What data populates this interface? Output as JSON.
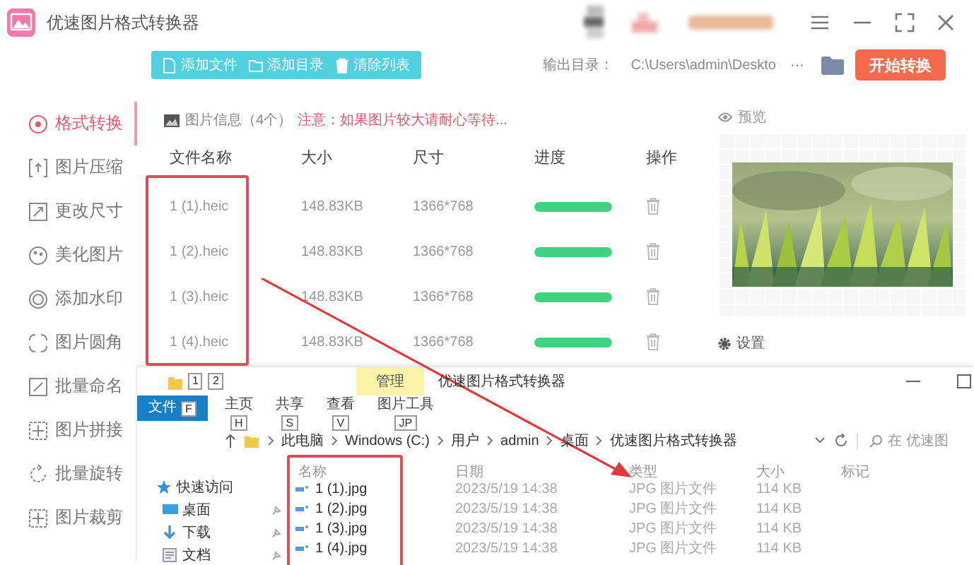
{
  "window": {
    "title": "优速图片格式转换器"
  },
  "toolbar": {
    "buttons": [
      "添加文件",
      "添加目录",
      "清除列表"
    ],
    "output_label": "输出目录：",
    "output_path": "C:\\Users\\admin\\Deskto",
    "more": "···",
    "start_button": "开始转换"
  },
  "sidebar": {
    "items": [
      {
        "label": "格式转换",
        "selected": true
      },
      {
        "label": "图片压缩",
        "selected": false
      },
      {
        "label": "更改尺寸",
        "selected": false
      },
      {
        "label": "美化图片",
        "selected": false
      },
      {
        "label": "添加水印",
        "selected": false
      },
      {
        "label": "图片圆角",
        "selected": false
      },
      {
        "label": "批量命名",
        "selected": false
      },
      {
        "label": "图片拼接",
        "selected": false
      },
      {
        "label": "批量旋转",
        "selected": false
      },
      {
        "label": "图片裁剪",
        "selected": false
      }
    ]
  },
  "file_panel": {
    "info_label": "图片信息（4个）",
    "notice": "注意：如果图片较大请耐心等待...",
    "columns": [
      "文件名称",
      "大小",
      "尺寸",
      "进度",
      "操作"
    ],
    "rows": [
      {
        "name": "1 (1).heic",
        "size": "148.83KB",
        "dimensions": "1366*768",
        "level": 1
      },
      {
        "name": "1 (2).heic",
        "size": "148.83KB",
        "dimensions": "1366*768",
        "level": 1
      },
      {
        "name": "1 (3).heic",
        "size": "148.83KB",
        "dimensions": "1366*768",
        "level": 1
      },
      {
        "name": "1 (4).heic",
        "size": "148.83KB",
        "dimensions": "1366*768",
        "level": 1
      }
    ]
  },
  "preview": {
    "title": "预览",
    "settings_label": "设置"
  },
  "explorer": {
    "quick_access_tips": [
      "1",
      "2"
    ],
    "context_tab": "管理",
    "title": "优速图片格式转换器",
    "ribbon": [
      {
        "label": "文件",
        "key_tip": "F",
        "selected": true
      },
      {
        "label": "主页",
        "key_tip": "H",
        "selected": false
      },
      {
        "label": "共享",
        "key_tip": "S",
        "selected": false
      },
      {
        "label": "查看",
        "key_tip": "V",
        "selected": false
      },
      {
        "label": "图片工具",
        "key_tip": "JP",
        "selected": false
      }
    ],
    "path": [
      "此电脑",
      "Windows (C:)",
      "用户",
      "admin",
      "桌面",
      "优速图片格式转换器"
    ],
    "search_placeholder": "在 优速图",
    "columns": [
      "名称",
      "日期",
      "类型",
      "大小",
      "标记"
    ],
    "nav": [
      {
        "label": "快速访问",
        "kind": "group"
      },
      {
        "label": "桌面",
        "kind": "item"
      },
      {
        "label": "下载",
        "kind": "item"
      },
      {
        "label": "文档",
        "kind": "item"
      }
    ],
    "files": [
      {
        "name": "1 (1).jpg",
        "date": "2023/5/19 14:38",
        "type": "JPG 图片文件",
        "size": "114 KB"
      },
      {
        "name": "1 (2).jpg",
        "date": "2023/5/19 14:38",
        "type": "JPG 图片文件",
        "size": "114 KB"
      },
      {
        "name": "1 (3).jpg",
        "date": "2023/5/19 14:38",
        "type": "JPG 图片文件",
        "size": "114 KB"
      },
      {
        "name": "1 (4).jpg",
        "date": "2023/5/19 14:38",
        "type": "JPG 图片文件",
        "size": "114 KB"
      }
    ]
  }
}
